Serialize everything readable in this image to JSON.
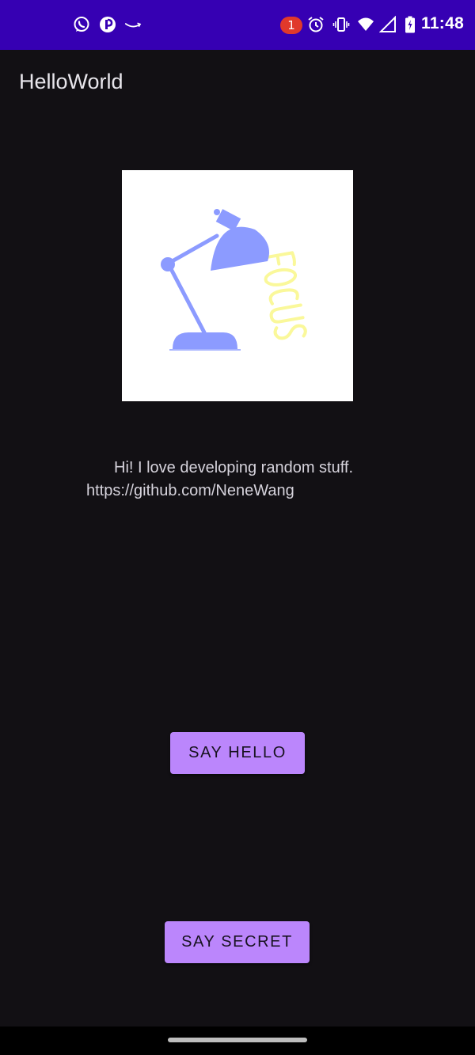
{
  "status_bar": {
    "notification_count": "1",
    "time": "11:48",
    "icons": [
      "whatsapp-icon",
      "app-icon",
      "amazon-icon",
      "alarm-icon",
      "vibrate-icon",
      "wifi-icon",
      "signal-icon",
      "battery-icon"
    ],
    "background": "#3600B3"
  },
  "app_bar": {
    "title": "HelloWorld"
  },
  "main": {
    "image": {
      "icon": "desk-lamp-icon",
      "lettering": "FOCUS"
    },
    "bio_line1": "Hi! I love developing random stuff.",
    "bio_line2": "https://github.com/NeneWang",
    "hello_button": "SAY HELLO",
    "secret_button": "SAY SECRET"
  },
  "colors": {
    "background": "#121014",
    "button": "#BB86FC",
    "lamp": "#8C9BFF",
    "lettering": "#FAF89A"
  }
}
